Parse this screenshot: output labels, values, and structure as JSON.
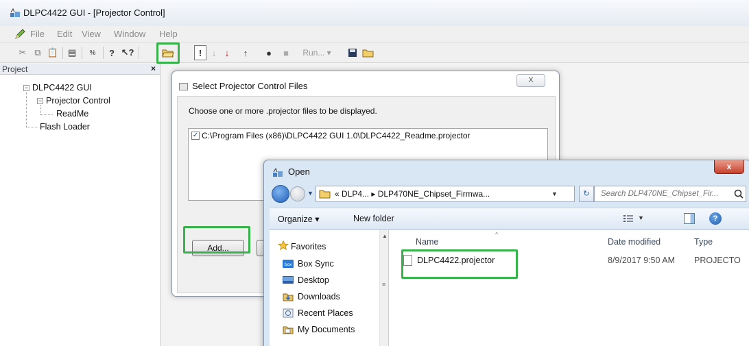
{
  "window": {
    "title": "DLPC4422 GUI - [Projector Control]"
  },
  "menu": {
    "items": [
      "File",
      "Edit",
      "View",
      "Window",
      "Help"
    ]
  },
  "toolbar": {
    "run_label": "Run..."
  },
  "project_panel": {
    "header": "Project",
    "close": "×",
    "tree": {
      "root": "DLPC4422 GUI",
      "projector_control": "Projector Control",
      "readme": "ReadMe",
      "flash_loader": "Flash Loader",
      "expand_glyph": "−"
    }
  },
  "select_dialog": {
    "title": "Select Projector Control Files",
    "close": "X",
    "instruction": "Choose one or more .projector files to be displayed.",
    "file_path": "C:\\Program Files (x86)\\DLPC4422 GUI 1.0\\DLPC4422_Readme.projector",
    "file_checked": "✓",
    "add_button": "Add..."
  },
  "open_dialog": {
    "title": "Open",
    "close": "x",
    "address": "« DLP4... ▸ DLP470NE_Chipset_Firmwa...",
    "search_placeholder": "Search DLP470NE_Chipset_Fir...",
    "organize": "Organize ▾",
    "new_folder": "New folder",
    "help": "?",
    "nav": {
      "favorites": "Favorites",
      "items": [
        "Box Sync",
        "Desktop",
        "Downloads",
        "Recent Places",
        "My Documents"
      ]
    },
    "columns": {
      "name": "Name",
      "date": "Date modified",
      "type": "Type"
    },
    "file": {
      "name": "DLPC4422.projector",
      "date": "8/9/2017 9:50 AM",
      "type": "PROJECTO"
    }
  },
  "colors": {
    "highlight": "#38b24a",
    "accent_blue": "#1f5fb8"
  }
}
